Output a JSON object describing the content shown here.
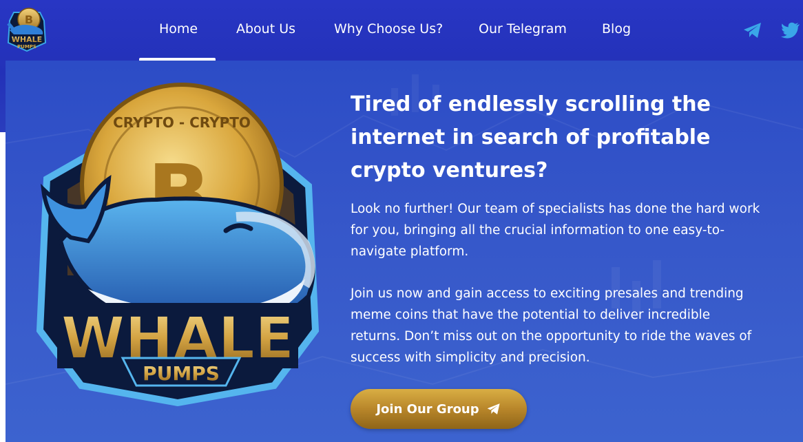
{
  "nav": {
    "items": [
      {
        "label": "Home",
        "active": true
      },
      {
        "label": "About Us"
      },
      {
        "label": "Why Choose Us?"
      },
      {
        "label": "Our Telegram"
      },
      {
        "label": "Blog"
      }
    ]
  },
  "logo": {
    "text_top": "WHALE",
    "text_bottom": "PUMPS"
  },
  "social": {
    "icons": [
      "telegram-icon",
      "twitter-icon"
    ],
    "color": "#3aa6e8"
  },
  "hero": {
    "headline": "Tired of endlessly scrolling the internet in search of profitable crypto ventures?",
    "paragraph1": "Look no further! Our team of specialists has done the hard work for you, bringing all the crucial information to one easy-to-navigate platform.",
    "paragraph2": "Join us now and gain access to exciting presales and trending meme coins that have the potential to deliver incredible returns. Don’t miss out on the opportunity to ride the waves of success with simplicity and precision.",
    "cta_label": "Join Our Group",
    "cta_icon": "telegram-icon",
    "mascot": {
      "coin_text": "CRYPTO - CRYPTO",
      "title": "WHALE",
      "subtitle": "PUMPS"
    }
  },
  "colors": {
    "nav_bg": "#2331b8",
    "hero_bg": "#3556c9",
    "gold": "#c9992f",
    "accent_blue": "#3aa6e8"
  }
}
